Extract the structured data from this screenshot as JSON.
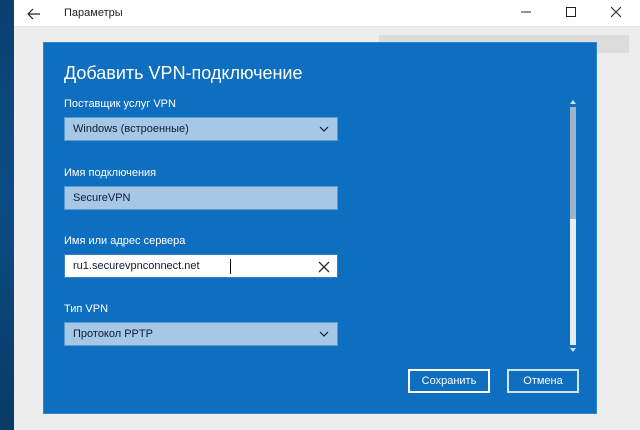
{
  "window": {
    "title": "Параметры",
    "back_icon": "back-arrow-icon",
    "min_icon": "minimize-icon",
    "max_icon": "maximize-icon",
    "close_icon": "close-icon"
  },
  "dialog": {
    "title": "Добавить VPN-подключение",
    "provider": {
      "label": "Поставщик услуг VPN",
      "value": "Windows (встроенные)"
    },
    "connection_name": {
      "label": "Имя подключения",
      "value": "SecureVPN"
    },
    "server": {
      "label": "Имя или адрес сервера",
      "value": "ru1.securevpnconnect.net"
    },
    "vpn_type": {
      "label": "Тип VPN",
      "value": "Протокол PPTP"
    },
    "save_label": "Сохранить",
    "cancel_label": "Отмена"
  },
  "colors": {
    "dialog_bg": "#0e6ebf",
    "field_bg": "#a7c7e6",
    "input_active_bg": "#ffffff",
    "text_on_dialog": "#ffffff"
  }
}
